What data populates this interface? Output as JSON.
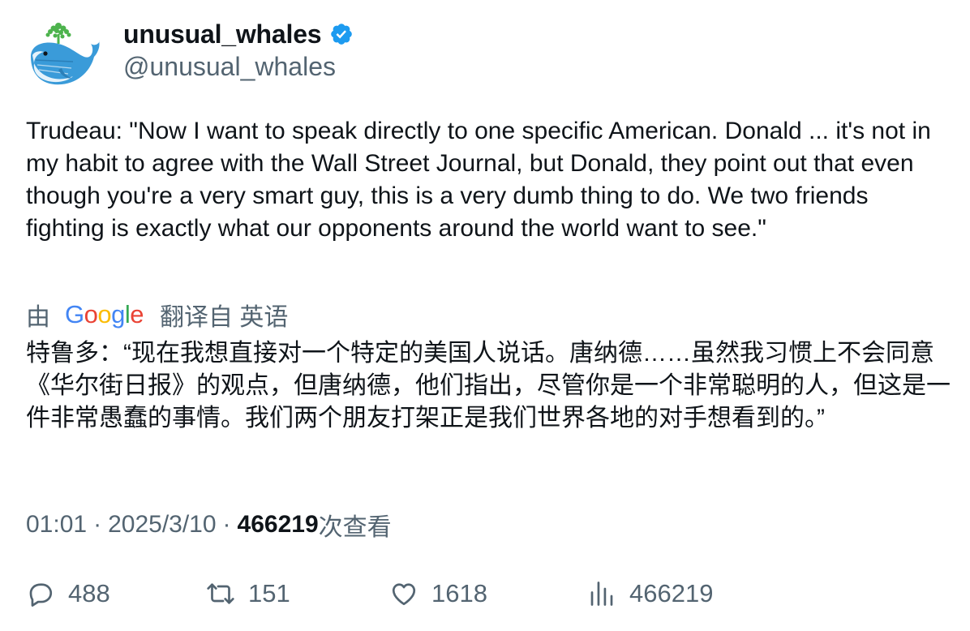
{
  "author": {
    "display_name": "unusual_whales",
    "handle": "@unusual_whales",
    "avatar_icon": "whale-logo",
    "verified_icon": "verified-badge-icon",
    "verified_color": "#1d9bf0"
  },
  "tweet": {
    "text": "Trudeau: \"Now I want to speak directly to one specific American. Donald ... it's not in my habit to agree with the Wall Street Journal, but Donald, they point out that even though you're a very smart guy, this is a very dumb thing to do. We two friends fighting is exactly what our opponents around the world want to see.\""
  },
  "translation": {
    "prefix": "由",
    "provider": "Google",
    "suffix": "翻译自 英语",
    "text": "特鲁多：“现在我想直接对一个特定的美国人说话。唐纳德……虽然我习惯上不会同意《华尔街日报》的观点，但唐纳德，他们指出，尽管你是一个非常聪明的人，但这是一件非常愚蠢的事情。我们两个朋友打架正是我们世界各地的对手想看到的。”"
  },
  "meta": {
    "time": "01:01",
    "separator": "·",
    "date": "2025/3/10",
    "views": "466219",
    "views_label": "次查看"
  },
  "actions": {
    "replies": "488",
    "retweets": "151",
    "likes": "1618",
    "views": "466219"
  },
  "colors": {
    "text_primary": "#0f1419",
    "text_secondary": "#536471",
    "google_blue": "#4285f4",
    "google_red": "#ea4335",
    "google_yellow": "#fbbc05",
    "google_green": "#34a853"
  }
}
